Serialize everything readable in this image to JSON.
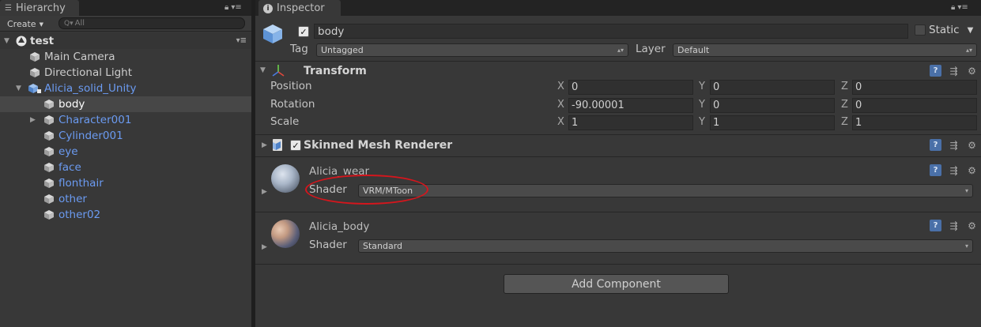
{
  "hierarchy": {
    "tab_title": "Hierarchy",
    "create_label": "Create",
    "search_placeholder": "All",
    "scene_name": "test",
    "items": [
      {
        "label": "Main Camera",
        "prefab": false
      },
      {
        "label": "Directional Light",
        "prefab": false
      },
      {
        "label": "Alicia_solid_Unity",
        "prefab": true
      },
      {
        "label": "body",
        "prefab": true,
        "selected": true
      },
      {
        "label": "Character001",
        "prefab": true
      },
      {
        "label": "Cylinder001",
        "prefab": true
      },
      {
        "label": "eye",
        "prefab": true
      },
      {
        "label": "face",
        "prefab": true
      },
      {
        "label": "flonthair",
        "prefab": true
      },
      {
        "label": "other",
        "prefab": true
      },
      {
        "label": "other02",
        "prefab": true
      }
    ]
  },
  "inspector": {
    "tab_title": "Inspector",
    "object_name": "body",
    "active": true,
    "static_label": "Static",
    "tag_label": "Tag",
    "tag_value": "Untagged",
    "layer_label": "Layer",
    "layer_value": "Default",
    "transform": {
      "title": "Transform",
      "rows": [
        {
          "label": "Position",
          "x": "0",
          "y": "0",
          "z": "0"
        },
        {
          "label": "Rotation",
          "x": "-90.00001",
          "y": "0",
          "z": "0"
        },
        {
          "label": "Scale",
          "x": "1",
          "y": "1",
          "z": "1"
        }
      ],
      "axis_x": "X",
      "axis_y": "Y",
      "axis_z": "Z"
    },
    "skinned_mesh_renderer": {
      "title": "Skinned Mesh Renderer",
      "enabled": true
    },
    "materials": [
      {
        "name": "Alicia_wear",
        "shader_label": "Shader",
        "shader": "VRM/MToon"
      },
      {
        "name": "Alicia_body",
        "shader_label": "Shader",
        "shader": "Standard"
      }
    ],
    "add_component_label": "Add Component"
  },
  "colors": {
    "selection_blue": "#6b9bf2",
    "highlight_red": "#d4161d",
    "panel_bg": "#383838"
  }
}
